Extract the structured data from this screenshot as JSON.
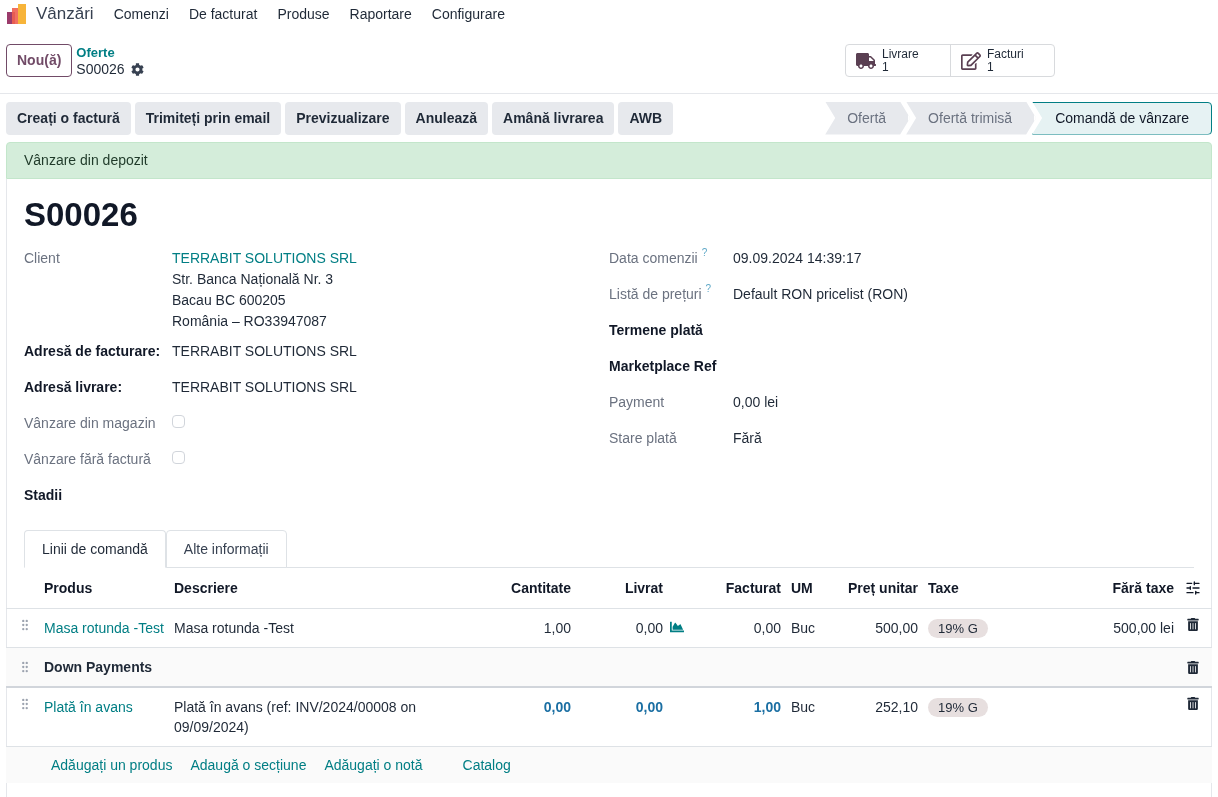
{
  "app": {
    "name": "Vânzări",
    "menu": [
      "Comenzi",
      "De facturat",
      "Produse",
      "Raportare",
      "Configurare"
    ]
  },
  "breadcrumb": {
    "new_button": "Nou(ă)",
    "parent": "Oferte",
    "record": "S00026"
  },
  "smart_buttons": [
    {
      "kind": "truck",
      "label": "Livrare",
      "count": "1"
    },
    {
      "kind": "invoice",
      "label": "Facturi",
      "count": "1"
    }
  ],
  "actions": [
    "Creați o factură",
    "Trimiteți prin email",
    "Previzualizare",
    "Anulează",
    "Amână livrarea",
    "AWB"
  ],
  "stages": [
    {
      "label": "Ofertă",
      "selected": false
    },
    {
      "label": "Ofertă trimisă",
      "selected": false
    },
    {
      "label": "Comandă de vânzare",
      "selected": true
    }
  ],
  "alert": "Vânzare din depozit",
  "record_title": "S00026",
  "left_fields": [
    {
      "kind": "link",
      "label": "Client",
      "emphasis": false,
      "value": "TERRABIT SOLUTIONS SRL",
      "lines": [
        "Str. Banca Națională Nr. 3",
        "Bacau BC 600205",
        "România – RO33947087"
      ]
    },
    {
      "kind": "text",
      "label": "Adresă de facturare:",
      "emphasis": true,
      "value": "TERRABIT SOLUTIONS SRL"
    },
    {
      "kind": "text",
      "label": "Adresă livrare:",
      "emphasis": true,
      "value": "TERRABIT SOLUTIONS SRL"
    },
    {
      "kind": "checkbox",
      "label": "Vânzare din magazin",
      "emphasis": false,
      "checked": false
    },
    {
      "kind": "checkbox",
      "label": "Vânzare fără factură",
      "emphasis": false,
      "checked": false
    },
    {
      "kind": "heading",
      "label": "Stadii",
      "emphasis": true
    }
  ],
  "right_fields": [
    {
      "kind": "text",
      "label": "Data comenzii",
      "help": "?",
      "emphasis": false,
      "value": "09.09.2024 14:39:17"
    },
    {
      "kind": "text",
      "label": "Listă de prețuri",
      "help": "?",
      "emphasis": false,
      "value": "Default RON pricelist (RON)"
    },
    {
      "kind": "heading",
      "label": "Termene plată",
      "emphasis": true
    },
    {
      "kind": "heading",
      "label": "Marketplace Ref",
      "emphasis": true
    },
    {
      "kind": "text",
      "label": "Payment",
      "emphasis": false,
      "value": "0,00 lei"
    },
    {
      "kind": "text",
      "label": "Stare plată",
      "emphasis": false,
      "value": "Fără"
    }
  ],
  "tabs": [
    {
      "label": "Linii de comandă",
      "selected": true
    },
    {
      "label": "Alte informații",
      "selected": false
    }
  ],
  "table": {
    "columns": [
      "Produs",
      "Descriere",
      "Cantitate",
      "Livrat",
      "Facturat",
      "UM",
      "Preț unitar",
      "Taxe",
      "Fără taxe"
    ],
    "rows": [
      {
        "kind": "product",
        "product": "Masa rotunda -Test",
        "description": "Masa rotunda -Test",
        "quantity": "1,00",
        "delivered": "0,00",
        "invoiced": "0,00",
        "uom": "Buc",
        "unit_price": "500,00",
        "tax": "19% G",
        "subtotal": "500,00 lei"
      },
      {
        "kind": "section",
        "title": "Down Payments"
      },
      {
        "kind": "down_payment",
        "product": "Plată în avans",
        "description": "Plată în avans (ref: INV/2024/00008 on 09/09/2024)",
        "quantity": "0,00",
        "delivered": "0,00",
        "invoiced": "1,00",
        "uom": "Buc",
        "unit_price": "252,10",
        "tax": "19% G"
      }
    ]
  },
  "add_links": [
    "Adăugați un produs",
    "Adaugă o secțiune",
    "Adăugați o notă",
    "Catalog"
  ]
}
